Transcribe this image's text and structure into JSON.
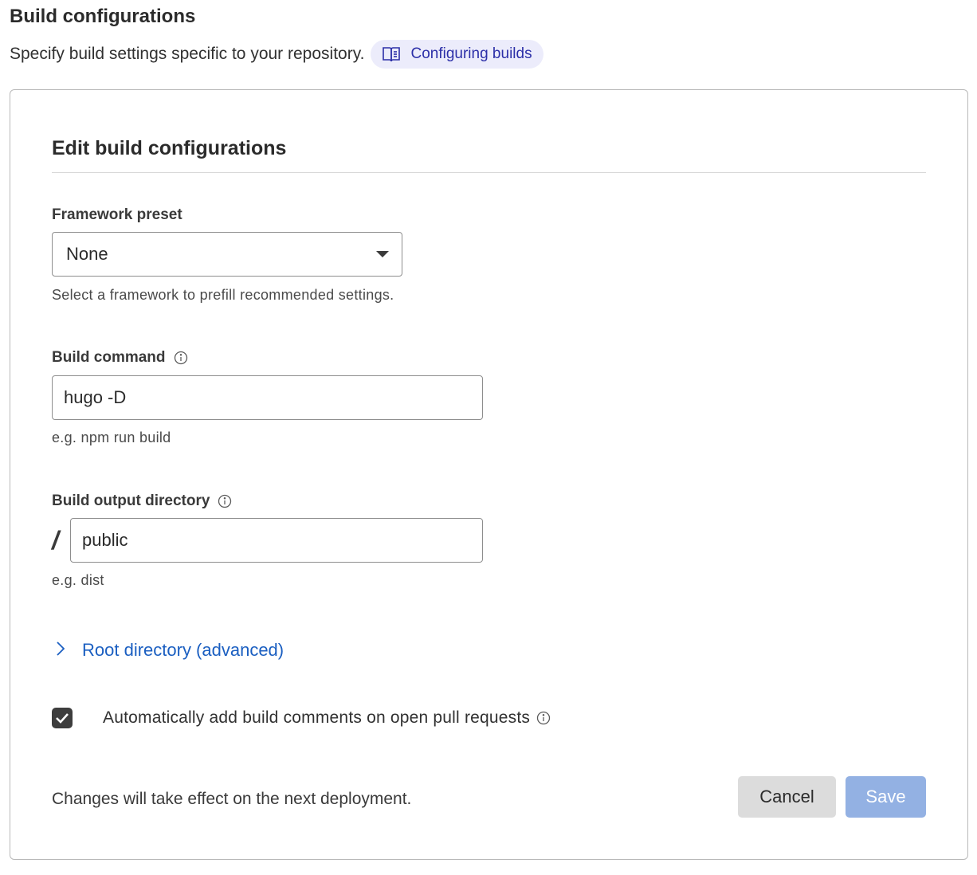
{
  "header": {
    "title": "Build configurations",
    "subtitle": "Specify build settings specific to your repository.",
    "doc_link_label": "Configuring builds",
    "doc_link_icon": "book-icon"
  },
  "card": {
    "title": "Edit build configurations",
    "framework_preset": {
      "label": "Framework preset",
      "selected": "None",
      "help": "Select a framework to prefill recommended settings."
    },
    "build_command": {
      "label": "Build command",
      "value": "hugo -D",
      "help": "e.g. npm run build"
    },
    "build_output_directory": {
      "label": "Build output directory",
      "prefix": "/",
      "value": "public",
      "help": "e.g. dist"
    },
    "root_directory": {
      "label": "Root directory (advanced)",
      "expanded": false
    },
    "build_comments": {
      "label": "Automatically add build comments on open pull requests",
      "checked": true
    },
    "footer_note": "Changes will take effect on the next deployment.",
    "cancel_label": "Cancel",
    "save_label": "Save"
  },
  "colors": {
    "link": "#1b5fc1",
    "pill_bg": "#ececfb",
    "pill_text": "#2c2fa8",
    "save_disabled": "#93b1e3",
    "cancel_bg": "#dcdcdc"
  }
}
